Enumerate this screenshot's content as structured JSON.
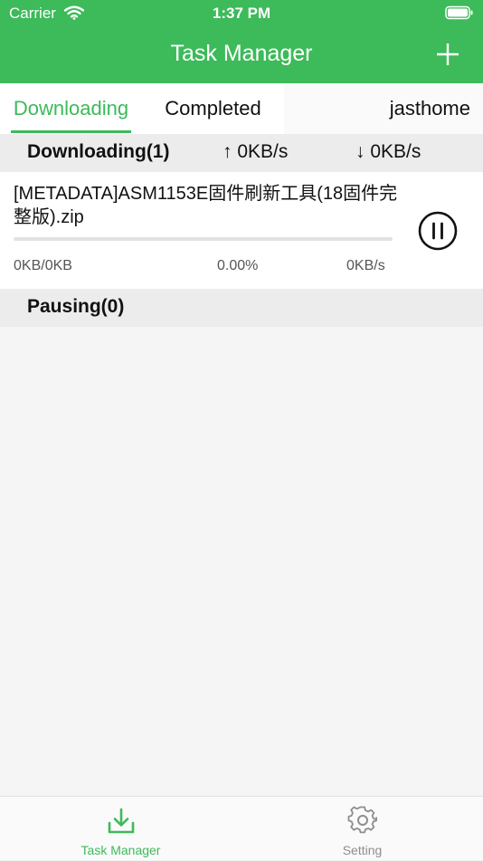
{
  "status_bar": {
    "carrier": "Carrier",
    "time": "1:37 PM"
  },
  "nav": {
    "title": "Task Manager",
    "add_icon": "plus-icon"
  },
  "tabs": {
    "downloading": "Downloading",
    "completed": "Completed",
    "account": "jasthome"
  },
  "downloading_section": {
    "title": "Downloading(1)",
    "upload_speed": "↑  0KB/s",
    "download_speed": "↓  0KB/s"
  },
  "tasks": [
    {
      "name": "[METADATA]ASM1153E固件刷新工具(18固件完整版).zip",
      "size": "0KB/0KB",
      "percent": "0.00%",
      "progress": 0.0,
      "speed": "0KB/s",
      "action_icon": "pause-icon"
    }
  ],
  "pausing_section": {
    "title": "Pausing(0)"
  },
  "tabbar": {
    "task_manager": "Task Manager",
    "setting": "Setting"
  },
  "colors": {
    "accent": "#3dba5a",
    "inactive": "#8e8e8e"
  }
}
